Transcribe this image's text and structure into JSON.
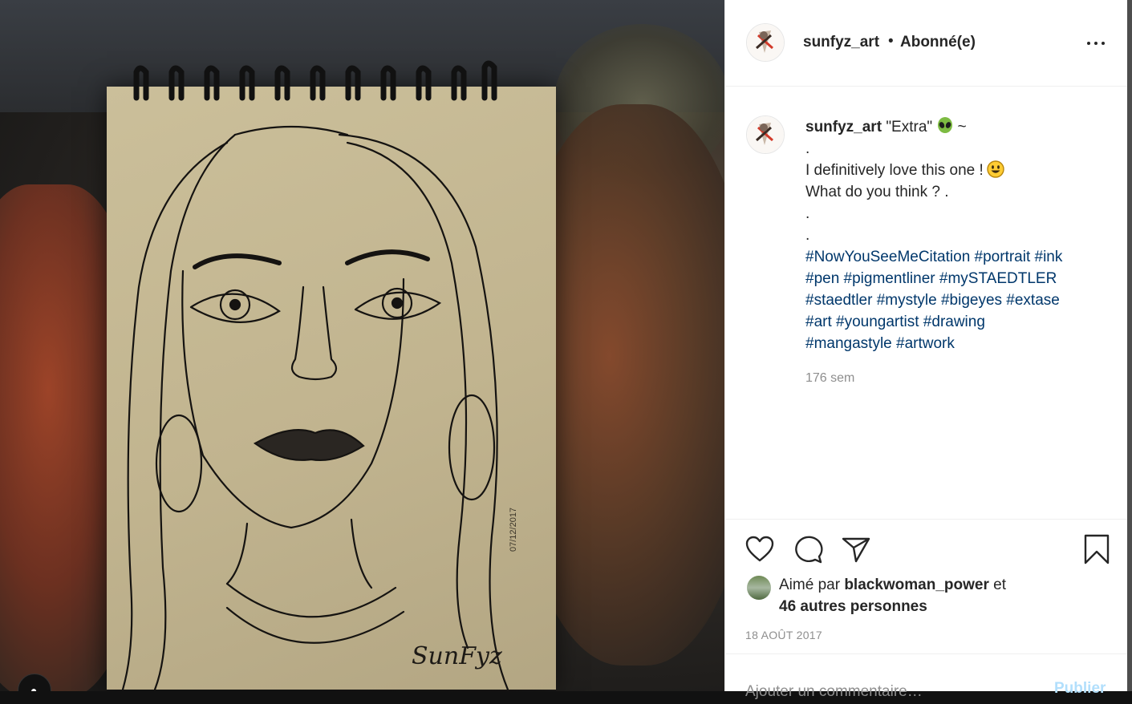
{
  "photo": {
    "alt": "",
    "signature_text": "SunFyz",
    "date_mark": "07/12/2017"
  },
  "header": {
    "username": "sunfyz_art",
    "separator": "•",
    "follow_status": "Abonné(e)"
  },
  "caption": {
    "username": "sunfyz_art",
    "title": "\"Extra\"",
    "title_suffix": "~",
    "lines": [
      ".",
      "I definitively love this one !",
      "What do you think ? .",
      ".",
      "."
    ],
    "hashtag_lines": [
      "#NowYouSeeMeCitation #portrait #ink",
      "#pen #pigmentliner #mySTAEDTLER",
      "#staedtler #mystyle #bigeyes #extase",
      "#art #youngartist #drawing",
      "#mangastyle #artwork"
    ],
    "time": "176 sem"
  },
  "likes": {
    "prefix": "Aimé par",
    "user": "blackwoman_power",
    "conjunction": "et",
    "others": "46 autres personnes"
  },
  "date": "18 AOÛT 2017",
  "comment": {
    "placeholder": "Ajouter un commentaire…",
    "publish_label": "Publier"
  },
  "icons": {
    "like": "heart-icon",
    "comment": "comment-bubble-icon",
    "share": "paper-plane-icon",
    "save": "bookmark-icon",
    "more": "more-dots-icon",
    "user_tag": "person-icon"
  },
  "colors": {
    "text": "#262626",
    "hashtag": "#00376b",
    "muted": "#8e8e8e",
    "publish": "#b2dffc"
  }
}
